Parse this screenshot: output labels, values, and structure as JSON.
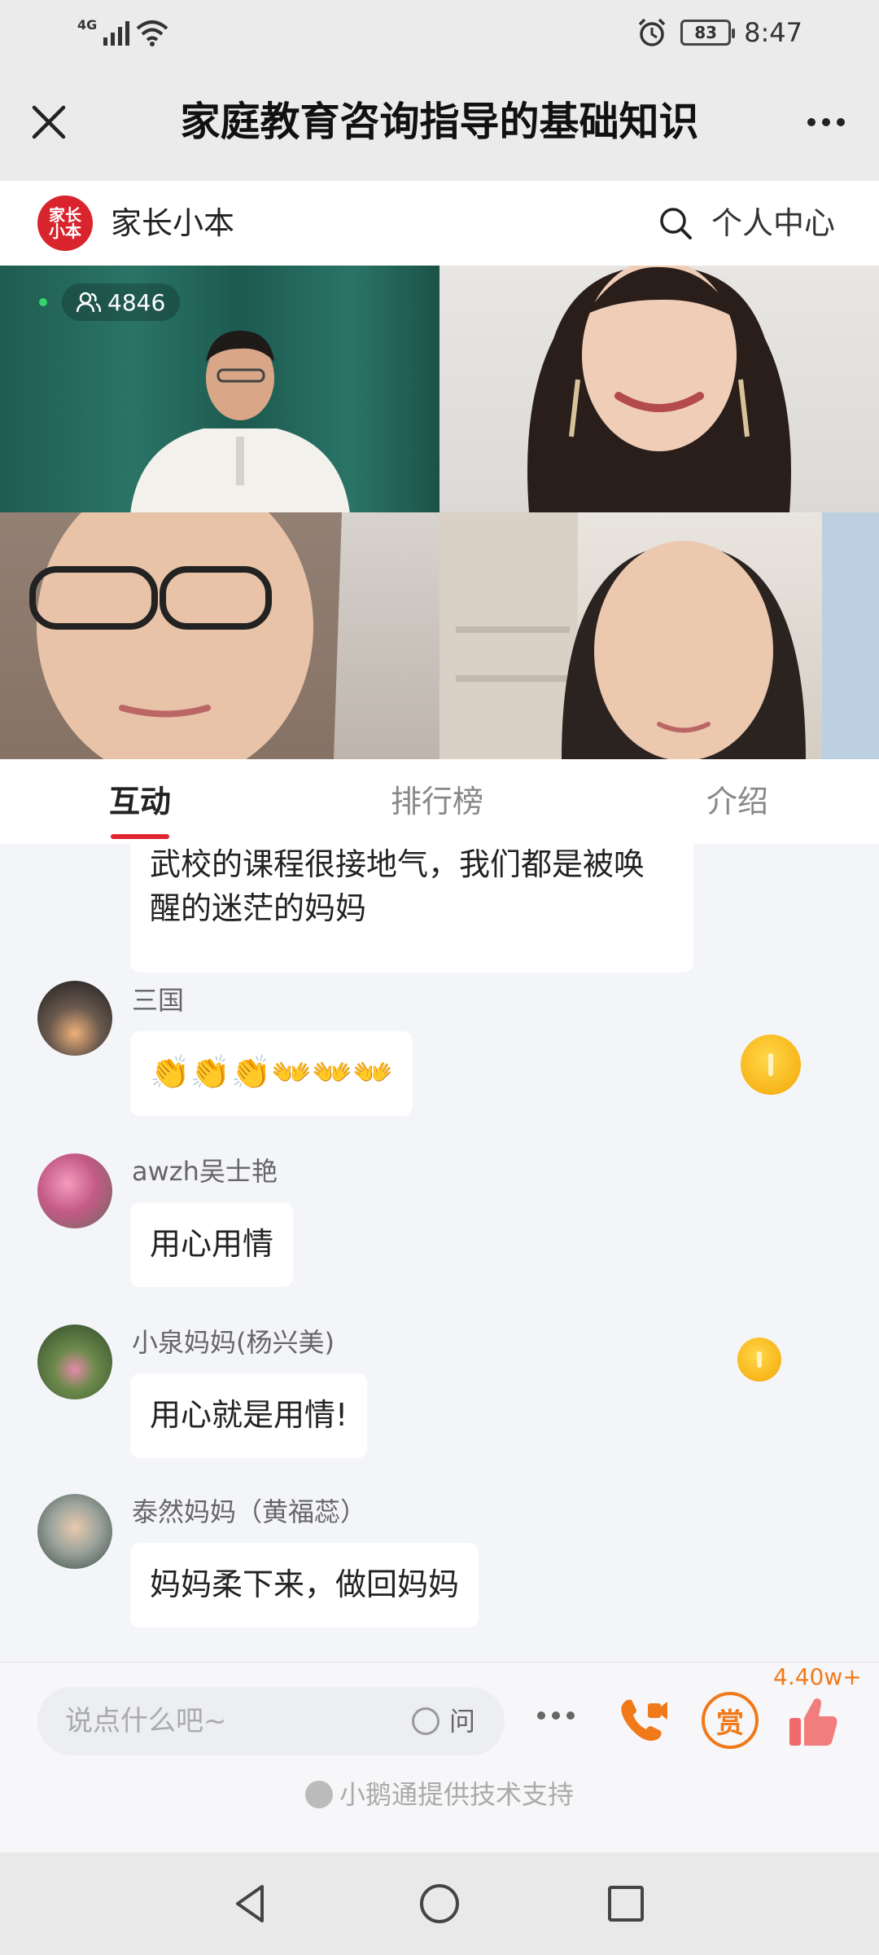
{
  "status_bar": {
    "network": "4G",
    "battery": "83",
    "time": "8:47"
  },
  "title_bar": {
    "title": "家庭教育咨询指导的基础知识"
  },
  "brand_bar": {
    "logo_text": "家长\n小本",
    "name": "家长小本",
    "personal_center": "个人中心"
  },
  "video": {
    "viewer_count": "4846"
  },
  "tabs": [
    {
      "label": "互动",
      "active": true
    },
    {
      "label": "排行榜",
      "active": false
    },
    {
      "label": "介绍",
      "active": false
    }
  ],
  "chat": {
    "partial_message": "武校的课程很接地气，我们都是被唤醒的迷茫的妈妈",
    "messages": [
      {
        "user": "三国",
        "text": "👏👏👏👐👐👐"
      },
      {
        "user": "awzh吴士艳",
        "text": "用心用情"
      },
      {
        "user": "小泉妈妈(杨兴美)",
        "text": "用心就是用情!"
      },
      {
        "user": "泰然妈妈（黄福蕊）",
        "text": "妈妈柔下来，做回妈妈"
      }
    ]
  },
  "input_bar": {
    "placeholder": "说点什么吧~",
    "ask_label": "问",
    "reward_label": "赏",
    "like_count": "4.40w+",
    "powered_by": "小鹅通提供技术支持"
  },
  "colors": {
    "accent_red": "#e0262f",
    "orange": "#f07a1a",
    "coin_gold": "#f8b51a"
  }
}
